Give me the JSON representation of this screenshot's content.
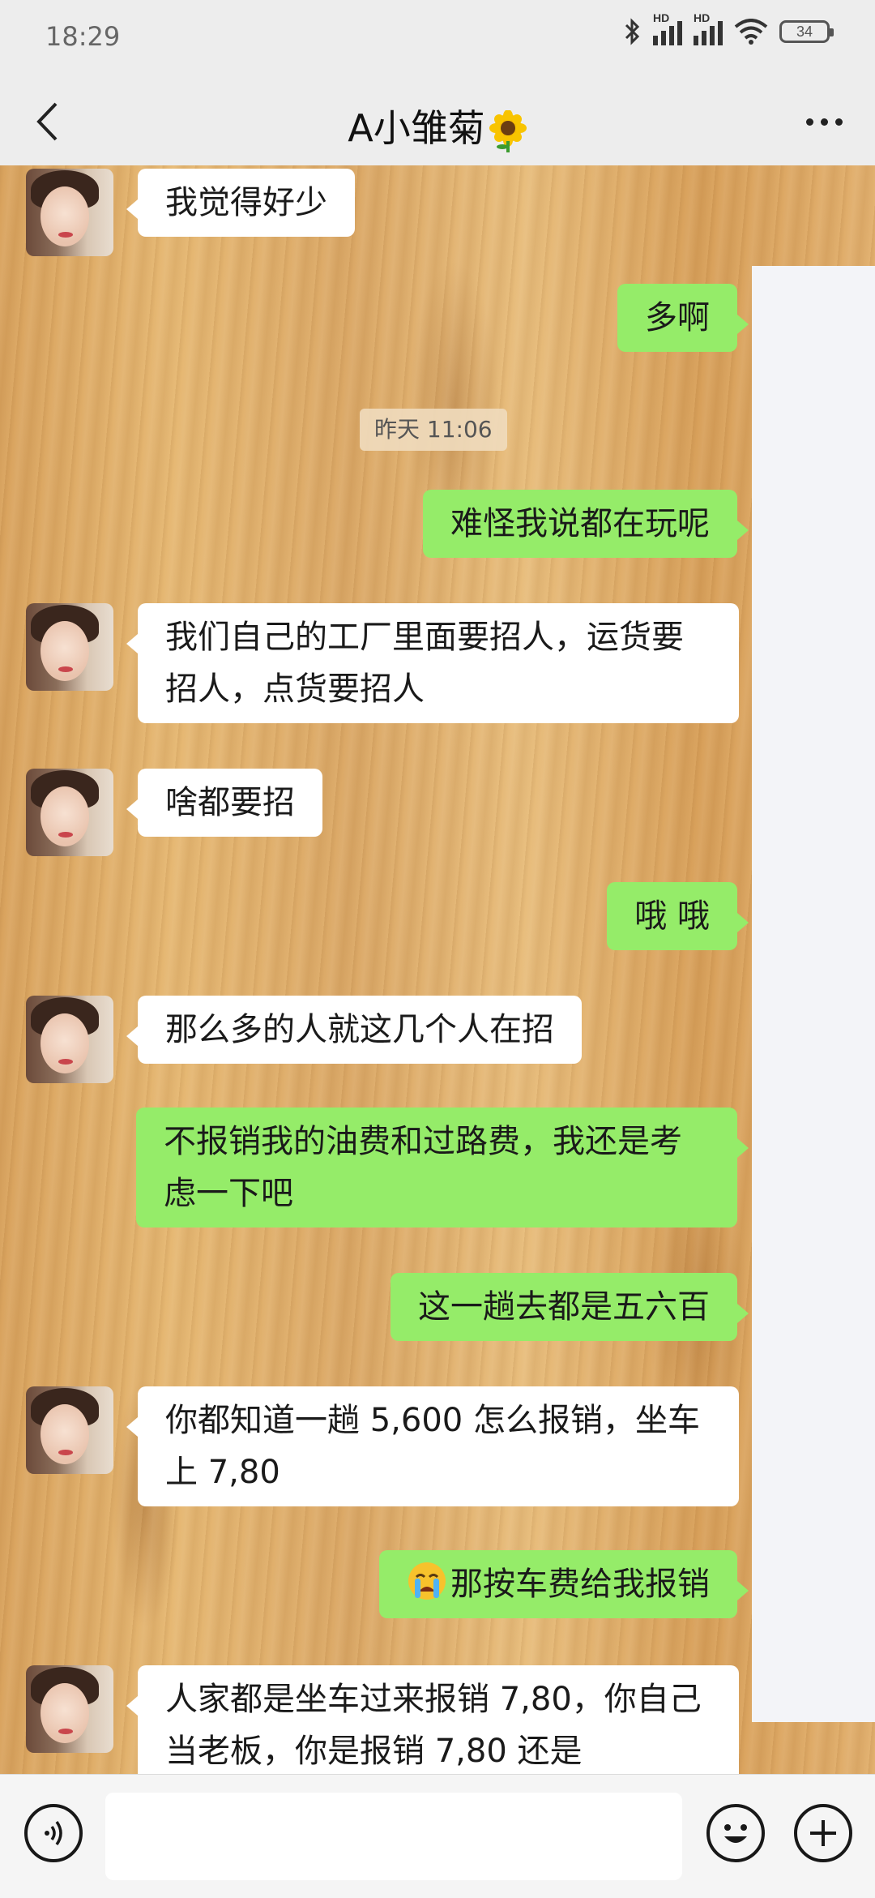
{
  "status_bar": {
    "time": "18:29",
    "battery": "34",
    "signal1_label": "HD",
    "signal2_label": "HD"
  },
  "header": {
    "title": "A小雏菊",
    "title_emoji": "sunflower-icon"
  },
  "messages": [
    {
      "side": "in",
      "text": "我觉得好少"
    },
    {
      "side": "out",
      "text": "多啊"
    },
    {
      "type": "time",
      "text": "昨天 11:06"
    },
    {
      "side": "out",
      "text": "难怪我说都在玩呢"
    },
    {
      "side": "in",
      "text": "我们自己的工厂里面要招人，运货要招人，点货要招人"
    },
    {
      "side": "in",
      "text": "啥都要招"
    },
    {
      "side": "out",
      "text": "哦  哦"
    },
    {
      "side": "in",
      "text": "那么多的人就这几个人在招"
    },
    {
      "side": "out",
      "text": "不报销我的油费和过路费，我还是考虑一下吧"
    },
    {
      "side": "out",
      "text": "这一趟去都是五六百"
    },
    {
      "side": "in",
      "text": "你都知道一趟 5,600 怎么报销，坐车上 7,80"
    },
    {
      "side": "out",
      "text": "那按车费给我报销",
      "emoji": "crying-face-icon"
    },
    {
      "side": "in",
      "text": "人家都是坐车过来报销 7,80，你自己当老板，你是报销 7,80 还是"
    }
  ],
  "input_bar": {
    "placeholder": "",
    "voice_icon": "voice-icon",
    "emoji_icon": "emoji-icon",
    "plus_icon": "plus-icon"
  },
  "colors": {
    "outgoing_bubble": "#95ec69",
    "incoming_bubble": "#ffffff",
    "header_bg": "#ededed"
  }
}
